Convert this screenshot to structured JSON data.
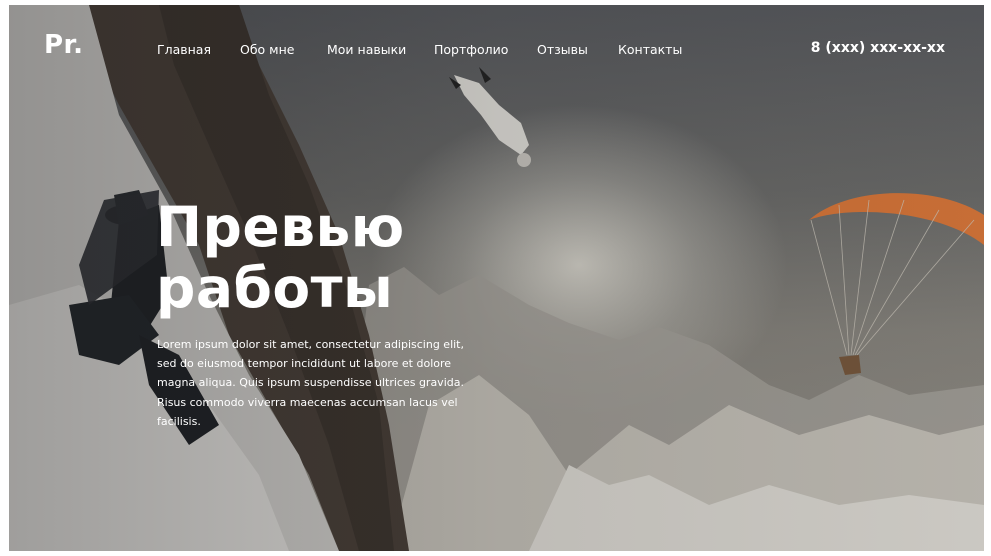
{
  "header": {
    "logo": "Pr.",
    "nav": [
      "Главная",
      "Обо мне",
      "Мои навыки",
      "Портфолио",
      "Отзывы",
      "Контакты"
    ],
    "phone": "8 (xxx) xxx-xx-xx"
  },
  "hero": {
    "title_line1": "Превью",
    "title_line2": "работы",
    "text": "Lorem ipsum dolor sit amet, consectetur adipiscing elit, sed do eiusmod tempor incididunt ut labore et dolore magna aliqua. Quis ipsum suspendisse ultrices gravida. Risus commodo viverra maecenas accumsan lacus vel facilisis."
  },
  "colors": {
    "text": "#ffffff",
    "parachute": "#e07a3a"
  }
}
